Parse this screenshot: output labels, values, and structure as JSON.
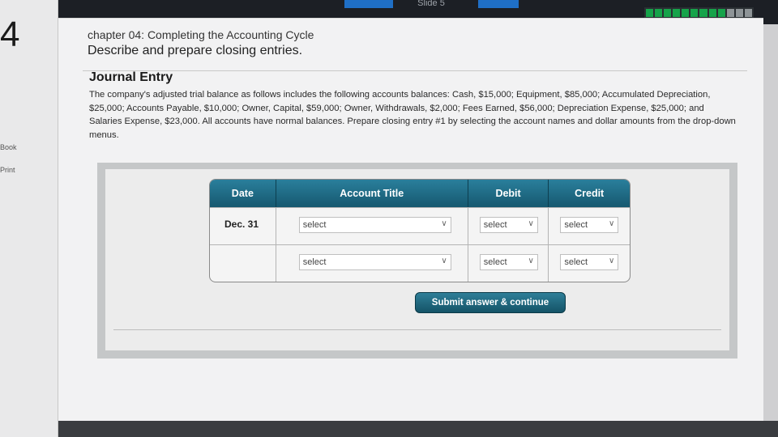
{
  "nav": {
    "prev_label": "",
    "next_label": "",
    "mid_label": "Slide 5"
  },
  "progress": {
    "filled_segments": 9,
    "total_segments": 12,
    "colors": {
      "filled": "#16a34a",
      "empty": "#8e9497"
    }
  },
  "gutter": {
    "question_number": "4",
    "links": [
      "Book",
      "Print"
    ]
  },
  "header": {
    "chapter": "chapter 04: Completing the Accounting Cycle",
    "section": "Describe and prepare closing entries."
  },
  "journal": {
    "title": "Journal Entry",
    "question": "The company's adjusted trial balance as follows includes the following accounts balances: Cash, $15,000; Equipment, $85,000; Accumulated Depreciation, $25,000; Accounts Payable, $10,000; Owner, Capital, $59,000; Owner, Withdrawals, $2,000; Fees Earned, $56,000; Depreciation Expense, $25,000; and Salaries Expense, $23,000. All accounts have normal balances. Prepare closing entry #1 by selecting the account names and dollar amounts from the drop-down menus.",
    "columns": [
      "Date",
      "Account Title",
      "Debit",
      "Credit"
    ],
    "rows": [
      {
        "date": "Dec. 31",
        "account": "select",
        "debit": "select",
        "credit": "select"
      },
      {
        "date": "",
        "account": "select",
        "debit": "select",
        "credit": "select"
      }
    ],
    "submit_label": "Submit answer & continue"
  },
  "theme": {
    "header_teal": "#16586f",
    "accent_blue": "#1f6fc6"
  }
}
